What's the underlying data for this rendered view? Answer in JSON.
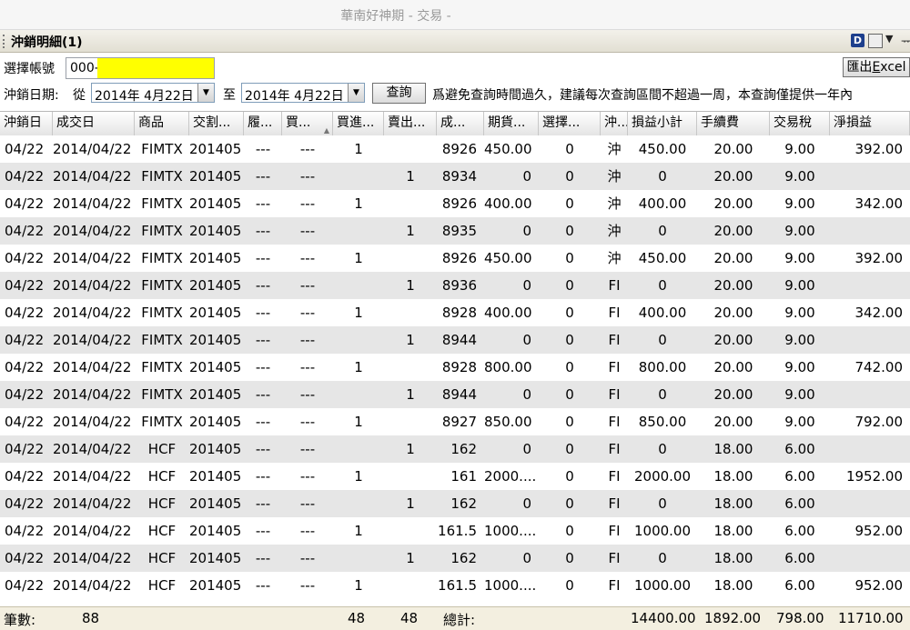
{
  "window": {
    "title": "華南好神期 - 交易 -"
  },
  "panel": {
    "title": "沖銷明細(1)",
    "d_icon": "D",
    "pin": "ᅲ"
  },
  "account": {
    "label": "選擇帳號",
    "value": "000-"
  },
  "excel_button": {
    "label": "匯出",
    "underlined": "E",
    "rest": "xcel"
  },
  "dates": {
    "label": "沖銷日期:",
    "from_label": "從",
    "from_value": "2014年  4月22日",
    "to_label": "至",
    "to_value": "2014年  4月22日"
  },
  "query_button": {
    "label": "查詢"
  },
  "note": "爲避免查詢時間過久，建議每次查詢區間不超過一周，本查詢僅提供一年內",
  "columns": [
    "沖銷日",
    "成交日",
    "商品",
    "交割...",
    "履...",
    "買...",
    "買進...",
    "賣出...",
    "成...",
    "期貨...",
    "選擇...",
    "沖...",
    "損益小計",
    "手續費",
    "交易稅",
    "淨損益"
  ],
  "rows": [
    [
      "04/22",
      "2014/04/22",
      "FIMTX",
      "201405",
      "---",
      "---",
      "1",
      "",
      "8926",
      "450.00",
      "0",
      "沖",
      "450.00",
      "20.00",
      "9.00",
      "392.00"
    ],
    [
      "04/22",
      "2014/04/22",
      "FIMTX",
      "201405",
      "---",
      "---",
      "",
      "1",
      "8934",
      "0",
      "0",
      "沖",
      "0",
      "20.00",
      "9.00",
      ""
    ],
    [
      "04/22",
      "2014/04/22",
      "FIMTX",
      "201405",
      "---",
      "---",
      "1",
      "",
      "8926",
      "400.00",
      "0",
      "沖",
      "400.00",
      "20.00",
      "9.00",
      "342.00"
    ],
    [
      "04/22",
      "2014/04/22",
      "FIMTX",
      "201405",
      "---",
      "---",
      "",
      "1",
      "8935",
      "0",
      "0",
      "沖",
      "0",
      "20.00",
      "9.00",
      ""
    ],
    [
      "04/22",
      "2014/04/22",
      "FIMTX",
      "201405",
      "---",
      "---",
      "1",
      "",
      "8926",
      "450.00",
      "0",
      "沖",
      "450.00",
      "20.00",
      "9.00",
      "392.00"
    ],
    [
      "04/22",
      "2014/04/22",
      "FIMTX",
      "201405",
      "---",
      "---",
      "",
      "1",
      "8936",
      "0",
      "0",
      "FI",
      "0",
      "20.00",
      "9.00",
      ""
    ],
    [
      "04/22",
      "2014/04/22",
      "FIMTX",
      "201405",
      "---",
      "---",
      "1",
      "",
      "8928",
      "400.00",
      "0",
      "FI",
      "400.00",
      "20.00",
      "9.00",
      "342.00"
    ],
    [
      "04/22",
      "2014/04/22",
      "FIMTX",
      "201405",
      "---",
      "---",
      "",
      "1",
      "8944",
      "0",
      "0",
      "FI",
      "0",
      "20.00",
      "9.00",
      ""
    ],
    [
      "04/22",
      "2014/04/22",
      "FIMTX",
      "201405",
      "---",
      "---",
      "1",
      "",
      "8928",
      "800.00",
      "0",
      "FI",
      "800.00",
      "20.00",
      "9.00",
      "742.00"
    ],
    [
      "04/22",
      "2014/04/22",
      "FIMTX",
      "201405",
      "---",
      "---",
      "",
      "1",
      "8944",
      "0",
      "0",
      "FI",
      "0",
      "20.00",
      "9.00",
      ""
    ],
    [
      "04/22",
      "2014/04/22",
      "FIMTX",
      "201405",
      "---",
      "---",
      "1",
      "",
      "8927",
      "850.00",
      "0",
      "FI",
      "850.00",
      "20.00",
      "9.00",
      "792.00"
    ],
    [
      "04/22",
      "2014/04/22",
      "HCF",
      "201405",
      "---",
      "---",
      "",
      "1",
      "162",
      "0",
      "0",
      "FI",
      "0",
      "18.00",
      "6.00",
      ""
    ],
    [
      "04/22",
      "2014/04/22",
      "HCF",
      "201405",
      "---",
      "---",
      "1",
      "",
      "161",
      "2000....",
      "0",
      "FI",
      "2000.00",
      "18.00",
      "6.00",
      "1952.00"
    ],
    [
      "04/22",
      "2014/04/22",
      "HCF",
      "201405",
      "---",
      "---",
      "",
      "1",
      "162",
      "0",
      "0",
      "FI",
      "0",
      "18.00",
      "6.00",
      ""
    ],
    [
      "04/22",
      "2014/04/22",
      "HCF",
      "201405",
      "---",
      "---",
      "1",
      "",
      "161.5",
      "1000....",
      "0",
      "FI",
      "1000.00",
      "18.00",
      "6.00",
      "952.00"
    ],
    [
      "04/22",
      "2014/04/22",
      "HCF",
      "201405",
      "---",
      "---",
      "",
      "1",
      "162",
      "0",
      "0",
      "FI",
      "0",
      "18.00",
      "6.00",
      ""
    ],
    [
      "04/22",
      "2014/04/22",
      "HCF",
      "201405",
      "---",
      "---",
      "1",
      "",
      "161.5",
      "1000....",
      "0",
      "FI",
      "1000.00",
      "18.00",
      "6.00",
      "952.00"
    ]
  ],
  "footer": {
    "count_label": "筆數:",
    "count": "88",
    "buy_total": "48",
    "sell_total": "48",
    "total_label": "總計:",
    "pnl_total": "14400.00",
    "fee_total": "1892.00",
    "tax_total": "798.00",
    "net_total": "11710.00"
  },
  "colors": {
    "account_mask": "#ffff00",
    "row_alt": "#e6e6e6",
    "footer_bg": "#f3efe0"
  }
}
